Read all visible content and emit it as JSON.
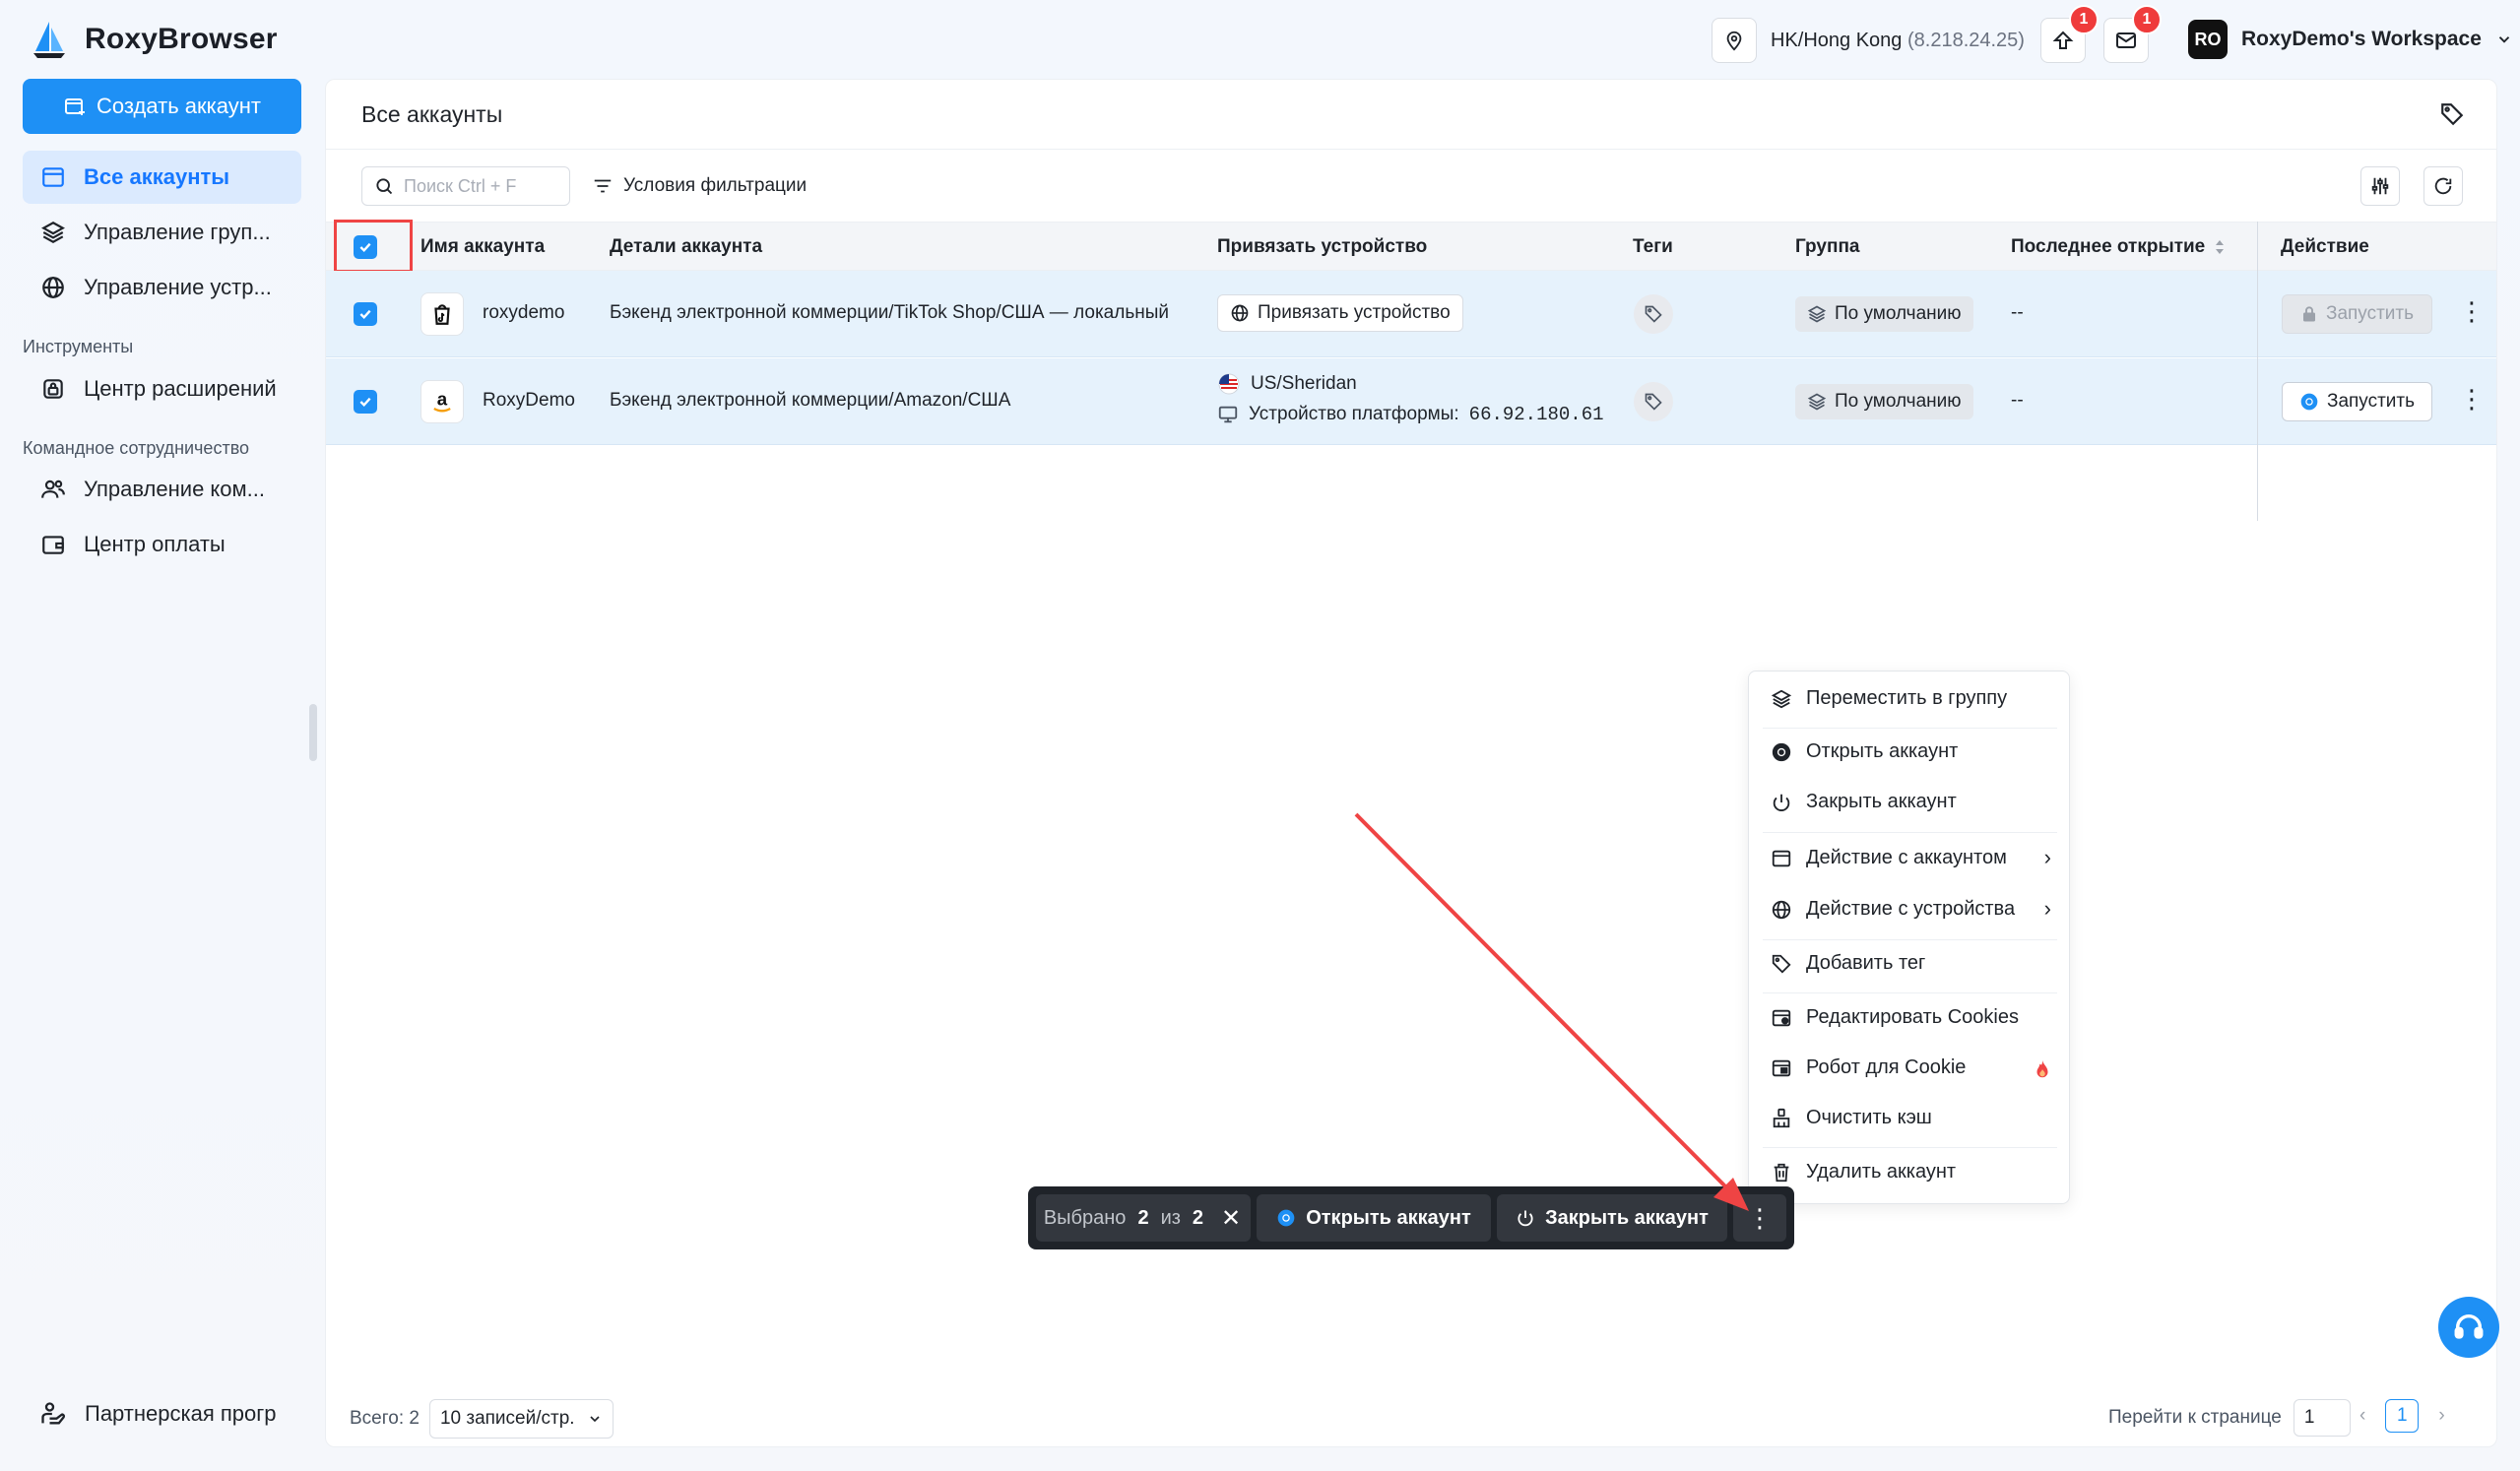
{
  "app": {
    "name": "RoxyBrowser",
    "location": "HK/Hong Kong",
    "ip": "(8.218.24.25)",
    "notif_count": "1",
    "mail_count": "1",
    "workspace_initials": "RO",
    "workspace_name": "RoxyDemo's Workspace"
  },
  "sidebar": {
    "create_label": "Создать аккаунт",
    "items": [
      {
        "label": "Все аккаунты"
      },
      {
        "label": "Управление груп..."
      },
      {
        "label": "Управление устр..."
      }
    ],
    "tools_section": "Инструменты",
    "tools_items": [
      {
        "label": "Центр расширений"
      }
    ],
    "team_section": "Командное сотрудничество",
    "team_items": [
      {
        "label": "Управление ком..."
      },
      {
        "label": "Центр оплаты"
      }
    ],
    "partner_label": "Партнерская прогр"
  },
  "main": {
    "title": "Все аккаунты",
    "search_placeholder": "Поиск Ctrl + F",
    "filter_label": "Условия фильтрации",
    "columns": {
      "name": "Имя аккаунта",
      "details": "Детали аккаунта",
      "bind": "Привязать устройство",
      "tags": "Теги",
      "group": "Группа",
      "last_open": "Последнее открытие",
      "action": "Действие"
    },
    "rows": [
      {
        "name": "roxydemo",
        "details": "Бэкенд электронной коммерции/TikTok Shop/США — локальный",
        "bind_button": "Привязать устройство",
        "group": "По умолчанию",
        "last_open": "--",
        "launch": "Запустить"
      },
      {
        "name": "RoxyDemo",
        "details": "Бэкенд электронной коммерции/Amazon/США",
        "device_location": "US/Sheridan",
        "device_platform_label": "Устройство платформы:",
        "device_ip": "66.92.180.61",
        "group": "По умолчанию",
        "last_open": "--",
        "launch": "Запустить"
      }
    ]
  },
  "bulk_bar": {
    "selected_prefix": "Выбрано",
    "selected_count": "2",
    "selected_of": "из",
    "selected_total": "2",
    "open_label": "Открыть аккаунт",
    "close_label": "Закрыть аккаунт"
  },
  "menu": {
    "items": [
      {
        "label": "Переместить в группу",
        "icon": "layers-icon"
      },
      {
        "label": "Открыть аккаунт",
        "icon": "chrome-icon"
      },
      {
        "label": "Закрыть аккаунт",
        "icon": "power-icon"
      },
      {
        "label": "Действие с аккаунтом",
        "icon": "window-icon"
      },
      {
        "label": "Действие с устройства",
        "icon": "globe-icon"
      },
      {
        "label": "Добавить тег",
        "icon": "tag-icon"
      },
      {
        "label": "Редактировать Cookies",
        "icon": "cookie-edit-icon"
      },
      {
        "label": "Робот для Cookie",
        "icon": "cookie-robot-icon"
      },
      {
        "label": "Очистить кэш",
        "icon": "broom-icon"
      },
      {
        "label": "Удалить аккаунт",
        "icon": "trash-icon"
      }
    ]
  },
  "footer": {
    "total_label": "Всего: 2",
    "page_size": "10 записей/стр.",
    "goto_label": "Перейти к странице",
    "goto_value": "1",
    "current_page": "1"
  },
  "colors": {
    "accent": "#1e90f5",
    "badge": "#ef3b3b",
    "row_selected": "#e6f2fc",
    "highlight": "#ef4444"
  }
}
